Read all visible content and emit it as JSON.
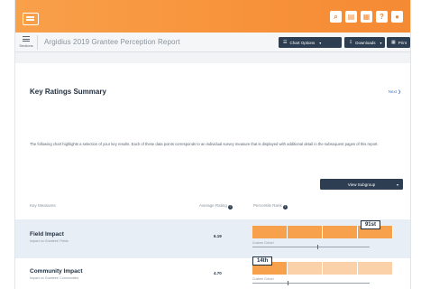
{
  "app": {
    "logo_icon": "logo-grid-icon",
    "top_icons": [
      {
        "name": "search-icon",
        "glyph": "⌕"
      },
      {
        "name": "document-icon",
        "glyph": "▤"
      },
      {
        "name": "print-icon",
        "glyph": "▦"
      },
      {
        "name": "help-icon",
        "glyph": "?"
      },
      {
        "name": "user-icon",
        "glyph": "●"
      }
    ],
    "accent_color": "#f7923a",
    "dark_color": "#2e3e52"
  },
  "header": {
    "sections_label": "Sections",
    "title": "Argidius 2019 Grantee Perception Report",
    "chart_options_label": "Chart Options",
    "downloads_label": "Downloads",
    "print_label": "Print"
  },
  "summary": {
    "title": "Key Ratings Summary",
    "next_label": "Next ❯",
    "intro": "The following chart highlights a selection of your key results. Each of these data points corresponds to an individual survey measure that is displayed with additional detail in the subsequent pages of this report.",
    "subgroup_button": "View Subgroup"
  },
  "columns": {
    "key_measures": "Key Measures",
    "average_rating": "Average Rating",
    "percentile_rank": "Percentile Rank"
  },
  "rows": [
    {
      "name": "Field Impact",
      "subtitle": "Impact on Grantees' Fields",
      "rating": "6.19",
      "percentile": "91st",
      "percentile_value": 91,
      "cohort_label": "Custom Cohort",
      "cohort_value": 55
    },
    {
      "name": "Community Impact",
      "subtitle": "Impact on Grantees' Communities",
      "rating": "4.70",
      "percentile": "14th",
      "percentile_value": 14,
      "cohort_label": "Custom Cohort",
      "cohort_value": 30
    }
  ]
}
